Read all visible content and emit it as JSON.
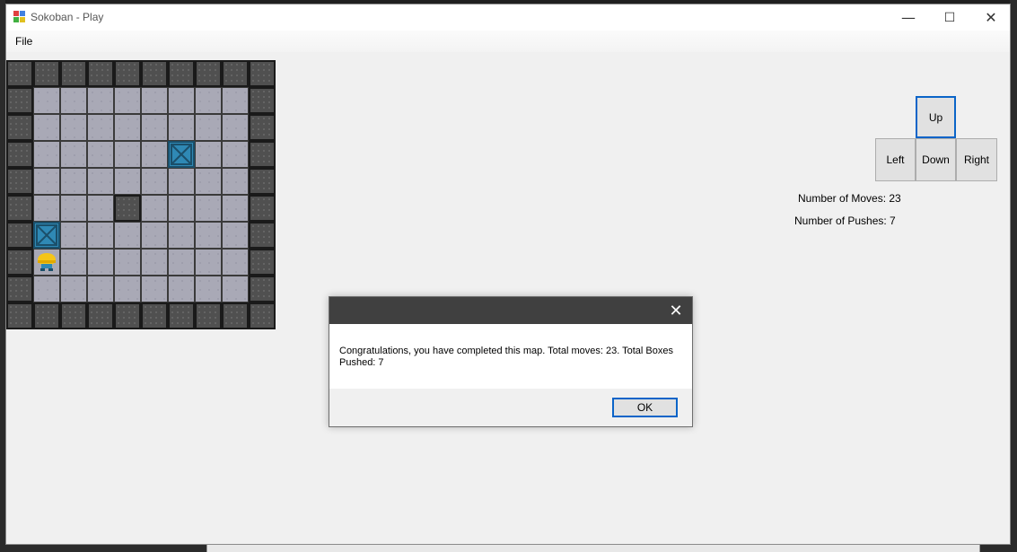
{
  "window": {
    "title": "Sokoban - Play",
    "minimize_symbol": "—",
    "maximize_symbol": "☐",
    "close_symbol": "✕"
  },
  "menu": {
    "file_label": "File"
  },
  "board": {
    "rows": [
      "WWWWWWWWWW",
      "W........W",
      "W........W",
      "W.....B..W",
      "W........W",
      "W...W....W",
      "WB.......W",
      "WP.......W",
      "W........W",
      "WWWWWWWWWW"
    ],
    "legend": {
      "W": "wall",
      ".": "floor",
      "B": "box",
      "P": "player"
    }
  },
  "controls": {
    "up": "Up",
    "left": "Left",
    "down": "Down",
    "right": "Right"
  },
  "stats": {
    "moves_label": "Number of Moves: 23",
    "pushes_label": "Number of Pushes: 7"
  },
  "dialog": {
    "close_symbol": "✕",
    "message": "Congratulations, you have completed this map. Total moves: 23. Total Boxes Pushed: 7",
    "ok_label": "OK"
  },
  "colors": {
    "box": "#2f89b5",
    "wall": "#505050",
    "floor": "#a9a9b6",
    "focus": "#0a64c8",
    "dialog_titlebar": "#404040"
  }
}
